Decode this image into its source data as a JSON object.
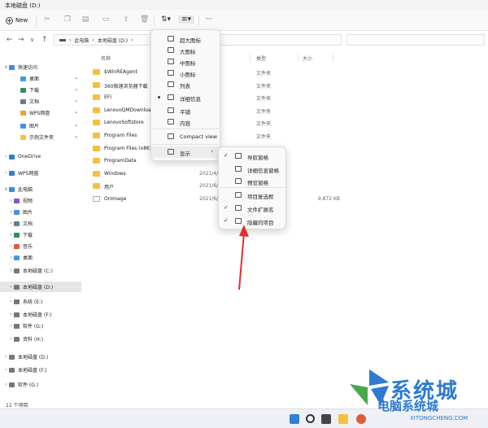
{
  "window": {
    "title": "本地磁盘 (D:)"
  },
  "toolbar": {
    "new_label": "New",
    "more": "···"
  },
  "address": {
    "breadcrumb": [
      "此电脑",
      "本地磁盘 (D:)"
    ],
    "sep": "›"
  },
  "sidebar": {
    "items": [
      {
        "label": "快速访问",
        "chev": "∨",
        "color": "#3a8ee6"
      },
      {
        "label": "桌面",
        "chev": "",
        "color": "#3d9be9",
        "pin": "✦"
      },
      {
        "label": "下载",
        "chev": "",
        "color": "#2f8f5f",
        "pin": "✦"
      },
      {
        "label": "文档",
        "chev": "",
        "color": "#6b7b8c",
        "pin": "✦"
      },
      {
        "label": "WPS网盘",
        "chev": "",
        "color": "#e8a13a",
        "pin": "✦"
      },
      {
        "label": "图片",
        "chev": "",
        "color": "#4a90d9",
        "pin": "✦"
      },
      {
        "label": "示例文件夹",
        "chev": "",
        "color": "#f3c040",
        "pin": "✦"
      },
      {
        "label": "OneDrive",
        "chev": "›",
        "color": "#2f7fd6"
      },
      {
        "label": "WPS网盘",
        "chev": "›",
        "color": "#2f7fd6"
      },
      {
        "label": "此电脑",
        "chev": "∨",
        "color": "#3a8ee6"
      },
      {
        "label": "视频",
        "chev": "›",
        "color": "#8a56c8"
      },
      {
        "label": "图片",
        "chev": "›",
        "color": "#4a90d9"
      },
      {
        "label": "文档",
        "chev": "›",
        "color": "#6b7b8c"
      },
      {
        "label": "下载",
        "chev": "›",
        "color": "#2f8f5f"
      },
      {
        "label": "音乐",
        "chev": "›",
        "color": "#e05a3a"
      },
      {
        "label": "桌面",
        "chev": "›",
        "color": "#3d9be9"
      },
      {
        "label": "本地磁盘 (C:)",
        "chev": "›",
        "color": "#777777"
      },
      {
        "label": "本地磁盘 (D:)",
        "chev": "›",
        "color": "#777777"
      },
      {
        "label": "系统 (E:)",
        "chev": "›",
        "color": "#777777"
      },
      {
        "label": "本地磁盘 (F:)",
        "chev": "›",
        "color": "#777777"
      },
      {
        "label": "软件 (G:)",
        "chev": "›",
        "color": "#777777"
      },
      {
        "label": "资料 (H:)",
        "chev": "›",
        "color": "#777777"
      },
      {
        "label": "本地磁盘 (D:)",
        "chev": "›",
        "color": "#777777"
      },
      {
        "label": "本地磁盘 (F:)",
        "chev": "›",
        "color": "#777777"
      },
      {
        "label": "软件 (G:)",
        "chev": "›",
        "color": "#777777"
      }
    ]
  },
  "columns": {
    "name": "名称",
    "type": "类型",
    "size": "大小"
  },
  "files": [
    {
      "name": "$WinREAgent",
      "date": "2:15",
      "type": "文件夹",
      "size": "",
      "kind": "folder"
    },
    {
      "name": "360极速浏览器下载",
      "date": "3 17:26",
      "type": "文件夹",
      "size": "",
      "kind": "folder"
    },
    {
      "name": "EFI",
      "date": "6 17:18",
      "type": "文件夹",
      "size": "",
      "kind": "folder"
    },
    {
      "name": "LenovoQMDownload",
      "date": "6 19:40",
      "type": "文件夹",
      "size": "",
      "kind": "folder"
    },
    {
      "name": "LenovoSoftstore",
      "date": "6 23:31",
      "type": "文件夹",
      "size": "",
      "kind": "folder"
    },
    {
      "name": "Program Files",
      "date": "2:41",
      "type": "文件夹",
      "size": "",
      "kind": "folder"
    },
    {
      "name": "Program Files (x86)",
      "date": "6 15:00",
      "type": "文件夹",
      "size": "",
      "kind": "folder"
    },
    {
      "name": "ProgramData",
      "date": "",
      "type": "",
      "size": "",
      "kind": "folder"
    },
    {
      "name": "Windows",
      "date": "2021/4/",
      "type": "",
      "size": "",
      "kind": "folder"
    },
    {
      "name": "用户",
      "date": "2021/6/2",
      "type": "",
      "size": "",
      "kind": "folder"
    },
    {
      "name": "OnImage",
      "date": "2021/6/0",
      "type": "",
      "size": "9,872 KB",
      "kind": "file"
    }
  ],
  "view_menu": {
    "items": [
      {
        "label": "超大图标",
        "dot": false
      },
      {
        "label": "大图标",
        "dot": false
      },
      {
        "label": "中图标",
        "dot": false
      },
      {
        "label": "小图标",
        "dot": false
      },
      {
        "label": "列表",
        "dot": false
      },
      {
        "label": "详细信息",
        "dot": true
      },
      {
        "label": "平铺",
        "dot": false
      },
      {
        "label": "内容",
        "dot": false
      },
      {
        "label": "Compact view",
        "dot": false
      },
      {
        "label": "显示",
        "dot": false,
        "arrow": "›"
      }
    ]
  },
  "show_menu": {
    "items": [
      {
        "label": "导航窗格",
        "check": "✓"
      },
      {
        "label": "详细信息窗格",
        "check": ""
      },
      {
        "label": "预览窗格",
        "check": ""
      },
      {
        "label": "项目复选框",
        "check": ""
      },
      {
        "label": "文件扩展名",
        "check": "✓"
      },
      {
        "label": "隐藏的项目",
        "check": "✓"
      }
    ]
  },
  "status": {
    "count": "11 个项目"
  },
  "watermark": {
    "title": "系统城",
    "subtitle": "电脑系统城",
    "url": "XITONGCHENG.COM"
  },
  "colors": {
    "accent": "#2d7ad0",
    "arrow": "#e0302a",
    "folder": "#f3c040"
  }
}
